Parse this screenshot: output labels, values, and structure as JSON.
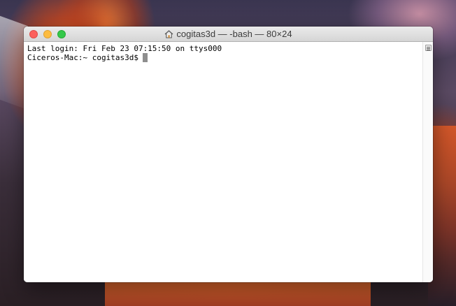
{
  "window": {
    "title": "cogitas3d — -bash — 80×24"
  },
  "terminal": {
    "lines": [
      "Last login: Fri Feb 23 07:15:50 on ttys000",
      "Ciceros-Mac:~ cogitas3d$"
    ]
  },
  "icons": {
    "home": "home-icon",
    "split": "split-view-icon"
  },
  "colors": {
    "close": "#fc605c",
    "minimize": "#fdbc40",
    "zoom": "#34c84a",
    "cursor": "#8e8e8e"
  }
}
